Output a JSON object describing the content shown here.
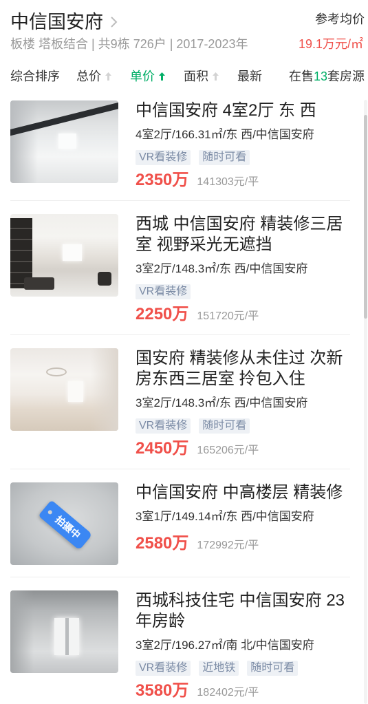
{
  "community": {
    "name": "中信国安府",
    "chevron_icon": "chevron-right-icon",
    "summary": "板楼 塔板结合 | 共9栋 726户 | 2017-2023年",
    "ref_price_label": "参考均价",
    "ref_price": "19.1万元/㎡"
  },
  "sort_bar": {
    "items": [
      {
        "label": "综合排序",
        "active": false
      },
      {
        "label": "总价",
        "icon": "up-arrow-icon",
        "active": false
      },
      {
        "label": "单价",
        "icon": "up-arrow-icon",
        "active": true
      },
      {
        "label": "面积",
        "icon": "up-arrow-icon",
        "active": false
      },
      {
        "label": "最新",
        "active": false
      }
    ],
    "count_prefix": "在售",
    "count": "13",
    "count_suffix": "套房源"
  },
  "listings": [
    {
      "title": "中信国安府 4室2厅 东 西",
      "details": "4室2厅/166.31㎡/东 西/中信国安府",
      "tags": [
        "VR看装修",
        "随时可看"
      ],
      "price": "2350万",
      "unit_price": "141303元/平"
    },
    {
      "title": "西城 中信国安府 精装修三居室 视野采光无遮挡",
      "details": "3室2厅/148.3㎡/东 西/中信国安府",
      "tags": [
        "VR看装修"
      ],
      "price": "2250万",
      "unit_price": "151720元/平"
    },
    {
      "title": "国安府 精装修从未住过 次新房东西三居室 拎包入住",
      "details": "3室2厅/148.3㎡/东 西/中信国安府",
      "tags": [
        "VR看装修",
        "随时可看"
      ],
      "price": "2450万",
      "unit_price": "165206元/平"
    },
    {
      "title": "中信国安府 中高楼层 精装修",
      "details": "3室1厅/149.14㎡/东 西/中信国安府",
      "tags": [],
      "photo_badge": "拍摄中",
      "price": "2580万",
      "unit_price": "172992元/平"
    },
    {
      "title": "西城科技住宅 中信国安府 23年房龄",
      "details": "3室2厅/196.27㎡/南 北/中信国安府",
      "tags": [
        "VR看装修",
        "近地铁",
        "随时可看"
      ],
      "price": "3580万",
      "unit_price": "182402元/平"
    }
  ],
  "colors": {
    "accent_green": "#00ae66",
    "price_red": "#f0504a",
    "tag_text": "#7b8ba5",
    "tag_bg": "#eef1f5",
    "muted_text": "#999999"
  }
}
